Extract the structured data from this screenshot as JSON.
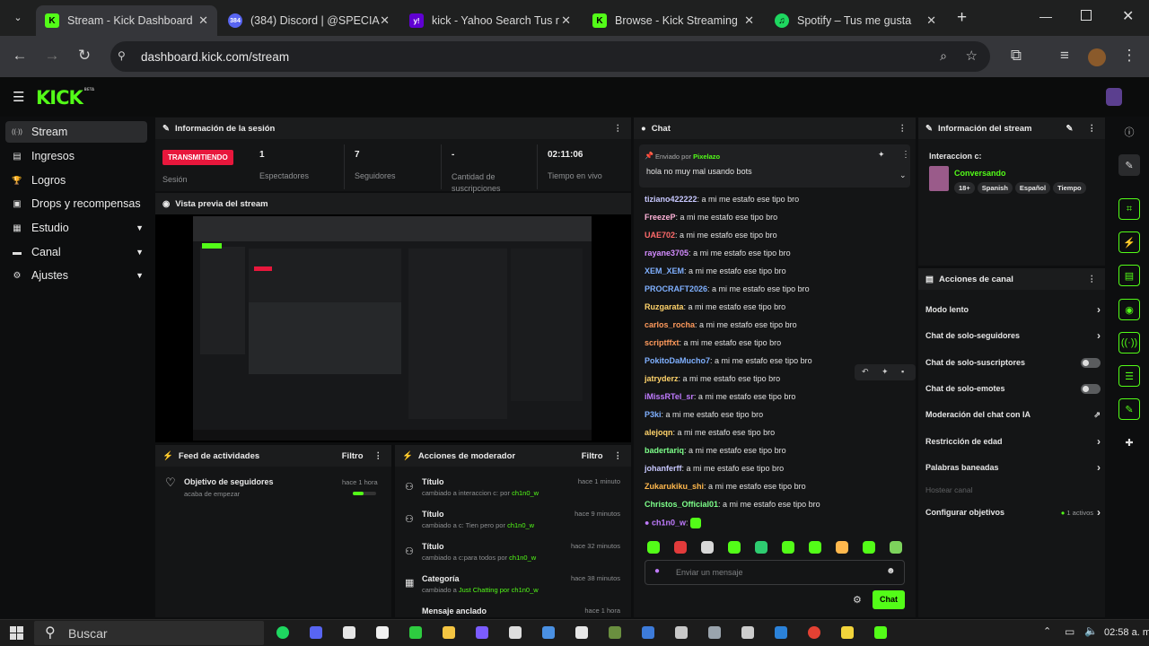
{
  "browser": {
    "tabs": [
      {
        "title": "Stream - Kick Dashboard",
        "icon": "K",
        "color": "#53fc18",
        "active": true
      },
      {
        "title": "(384) Discord | @SPECIAL",
        "icon": "384",
        "color": "#5865f2",
        "active": false
      },
      {
        "title": "kick - Yahoo Search Tus r",
        "icon": "y!",
        "color": "#6001d2",
        "active": false
      },
      {
        "title": "Browse - Kick Streaming",
        "icon": "K",
        "color": "#53fc18",
        "active": false
      },
      {
        "title": "Spotify – Tus me gusta",
        "icon": "♫",
        "color": "#1ed760",
        "active": false
      }
    ],
    "url": "dashboard.kick.com/stream"
  },
  "kick": {
    "logo": "KICK",
    "beta": "BETA"
  },
  "sidebar": {
    "items": [
      {
        "label": "Stream",
        "icon": "((·))"
      },
      {
        "label": "Ingresos",
        "icon": "▤"
      },
      {
        "label": "Logros",
        "icon": "🏆"
      },
      {
        "label": "Drops y recompensas",
        "icon": "▣"
      },
      {
        "label": "Estudio",
        "icon": "▦"
      },
      {
        "label": "Canal",
        "icon": "▬"
      },
      {
        "label": "Ajustes",
        "icon": "⚙"
      }
    ]
  },
  "session": {
    "title": "Información de la sesión",
    "status": "TRANSMITIENDO",
    "status_label": "Sesión",
    "stats": [
      {
        "value": "1",
        "label": "Espectadores"
      },
      {
        "value": "7",
        "label": "Seguidores"
      },
      {
        "value": "-",
        "label": "Cantidad de suscripciones"
      },
      {
        "value": "02:11:06",
        "label": "Tiempo en vivo"
      }
    ]
  },
  "preview": {
    "title": "Vista previa del stream"
  },
  "activity": {
    "title": "Feed de actividades",
    "filter": "Filtro",
    "item_title": "Objetivo de seguidores",
    "item_sub": "acaba de empezar",
    "item_time": "hace 1 hora",
    "progress": 0.45
  },
  "mod_actions": {
    "title": "Acciones de moderador",
    "filter": "Filtro",
    "rows": [
      {
        "title": "Título",
        "detail": "cambiado a interaccion c: por",
        "user": "ch1n0_w",
        "time": "hace 1 minuto"
      },
      {
        "title": "Título",
        "detail": "cambiado a c: Tien pero por",
        "user": "ch1n0_w",
        "time": "hace 9 minutos"
      },
      {
        "title": "Título",
        "detail": "cambiado a c:para todos por",
        "user": "ch1n0_w",
        "time": "hace 32 minutos"
      },
      {
        "title": "Categoría",
        "detail": "cambiado a",
        "user": "Just Chatting",
        "extra": "por ch1n0_w",
        "time": "hace 38 minutos"
      },
      {
        "title": "Mensaje anclado",
        "detail": "",
        "user": "",
        "time": "hace 1 hora"
      }
    ]
  },
  "chat": {
    "title": "Chat",
    "pinned_by": "Enviado por",
    "pinned_user": "Pixelazo",
    "pinned_msg": "hola no muy mal usando bots",
    "messages": [
      {
        "user": "tiziano422222",
        "color": "#c8c8ff",
        "text": "a mi me estafo ese tipo bro"
      },
      {
        "user": "FreezeP",
        "color": "#ffb3d9",
        "text": "a mi me estafo ese tipo bro"
      },
      {
        "user": "UAE702",
        "color": "#ff6b6b",
        "text": "a mi me estafo ese tipo bro"
      },
      {
        "user": "rayane3705",
        "color": "#d48cff",
        "text": "a mi me estafo ese tipo bro"
      },
      {
        "user": "XEM_XEM",
        "color": "#7fb0ff",
        "text": "a mi me estafo ese tipo bro"
      },
      {
        "user": "PROCRAFT2026",
        "color": "#7fb0ff",
        "text": "a mi me estafo ese tipo bro"
      },
      {
        "user": "Ruzgarata",
        "color": "#ffd36b",
        "text": "a mi me estafo ese tipo bro"
      },
      {
        "user": "carlos_rocha",
        "color": "#ff9a5c",
        "text": "a mi me estafo ese tipo bro"
      },
      {
        "user": "scriptffxt",
        "color": "#ff9a5c",
        "text": "a mi me estafo ese tipo bro"
      },
      {
        "user": "PokitoDaMucho7",
        "color": "#7fb0ff",
        "text": "a mi me estafo ese tipo bro"
      },
      {
        "user": "jatryderz",
        "color": "#ffd36b",
        "text": "a mi me estafo ese tipo bro"
      },
      {
        "user": "iMissRTel_sr",
        "color": "#c07bff",
        "text": "a mi me estafo ese tipo bro"
      },
      {
        "user": "P3ki",
        "color": "#7fb0ff",
        "text": "a mi me estafo ese tipo bro"
      },
      {
        "user": "alejoqn",
        "color": "#ffd36b",
        "text": "a mi me estafo ese tipo bro"
      },
      {
        "user": "badertariq",
        "color": "#7dff8a",
        "text": "a mi me estafo ese tipo bro"
      },
      {
        "user": "johanferff",
        "color": "#c8c8ff",
        "text": "a mi me estafo ese tipo bro"
      },
      {
        "user": "Zukarukiku_shi",
        "color": "#ffb84d",
        "text": "a mi me estafo ese tipo bro"
      },
      {
        "user": "Christos_Official01",
        "color": "#7dff8a",
        "text": "a mi me estafo ese tipo bro"
      }
    ],
    "last_user": "ch1n0_w",
    "input_placeholder": "Enviar un mensaje",
    "send": "Chat"
  },
  "stream_info": {
    "title": "Información del stream",
    "label": "Interaccion c:",
    "category": "Conversando",
    "tags": [
      "18+",
      "Spanish",
      "Español",
      "Tiempo"
    ]
  },
  "channel_actions": {
    "title": "Acciones de canal",
    "rows": [
      {
        "label": "Modo lento",
        "type": "arrow"
      },
      {
        "label": "Chat de solo-seguidores",
        "type": "arrow"
      },
      {
        "label": "Chat de solo-suscriptores",
        "type": "toggle"
      },
      {
        "label": "Chat de solo-emotes",
        "type": "toggle"
      },
      {
        "label": "Moderación del chat con IA",
        "type": "ext"
      },
      {
        "label": "Restricción de edad",
        "type": "arrow"
      },
      {
        "label": "Palabras baneadas",
        "type": "arrow"
      },
      {
        "label": "Hostear canal",
        "type": "disabled"
      },
      {
        "label": "Configurar objetivos",
        "type": "arrow",
        "badge": "1 activos"
      }
    ]
  },
  "taskbar": {
    "search": "Buscar",
    "time": "02:58 a. m."
  }
}
